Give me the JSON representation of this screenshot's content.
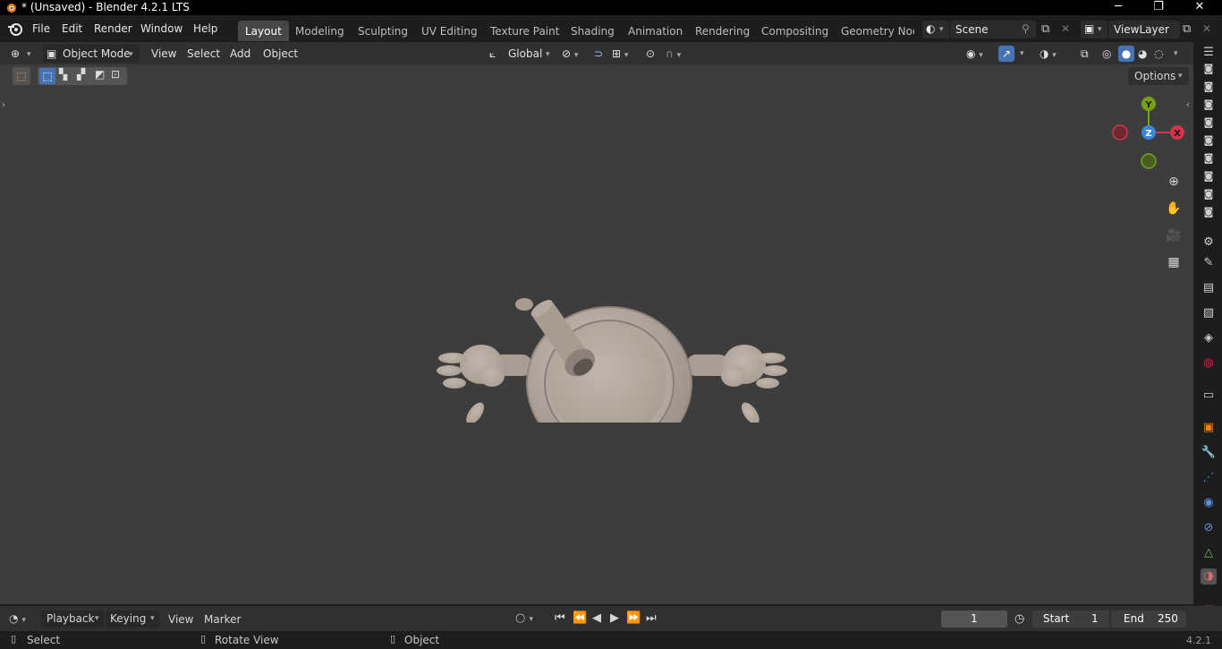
{
  "window": {
    "title": "* (Unsaved) - Blender 4.2.1 LTS",
    "minimize": "─",
    "maximize": "❐",
    "close": "✕"
  },
  "menu": {
    "file": "File",
    "edit": "Edit",
    "render": "Render",
    "window": "Window",
    "help": "Help"
  },
  "workspaces": [
    "Layout",
    "Modeling",
    "Sculpting",
    "UV Editing",
    "Texture Paint",
    "Shading",
    "Animation",
    "Rendering",
    "Compositing",
    "Geometry Node"
  ],
  "scene": {
    "name": "Scene",
    "view_layer": "ViewLayer"
  },
  "viewport_header": {
    "mode": "Object Mode",
    "view": "View",
    "select": "Select",
    "add": "Add",
    "object": "Object",
    "orientation": "Global"
  },
  "viewport": {
    "options": "Options"
  },
  "gizmo": {
    "y": "Y",
    "x": "X",
    "z": "Z"
  },
  "timeline": {
    "playback": "Playback",
    "keying": "Keying",
    "view": "View",
    "marker": "Marker",
    "current_frame": "1",
    "start_label": "Start",
    "start": "1",
    "end_label": "End",
    "end": "250"
  },
  "status": {
    "select": "Select",
    "rotate": "Rotate View",
    "object": "Object",
    "version": "4.2.1"
  },
  "colors": {
    "accent": "#4772b3",
    "viewport_bg": "#3d3d3d",
    "header_bg": "#303030",
    "model": "#b3a79d",
    "gizmo_x": "#d6324a",
    "gizmo_y": "#74a116",
    "gizmo_z": "#3b86d9"
  },
  "icons": {
    "blender_logo": "blender-logo-icon"
  }
}
